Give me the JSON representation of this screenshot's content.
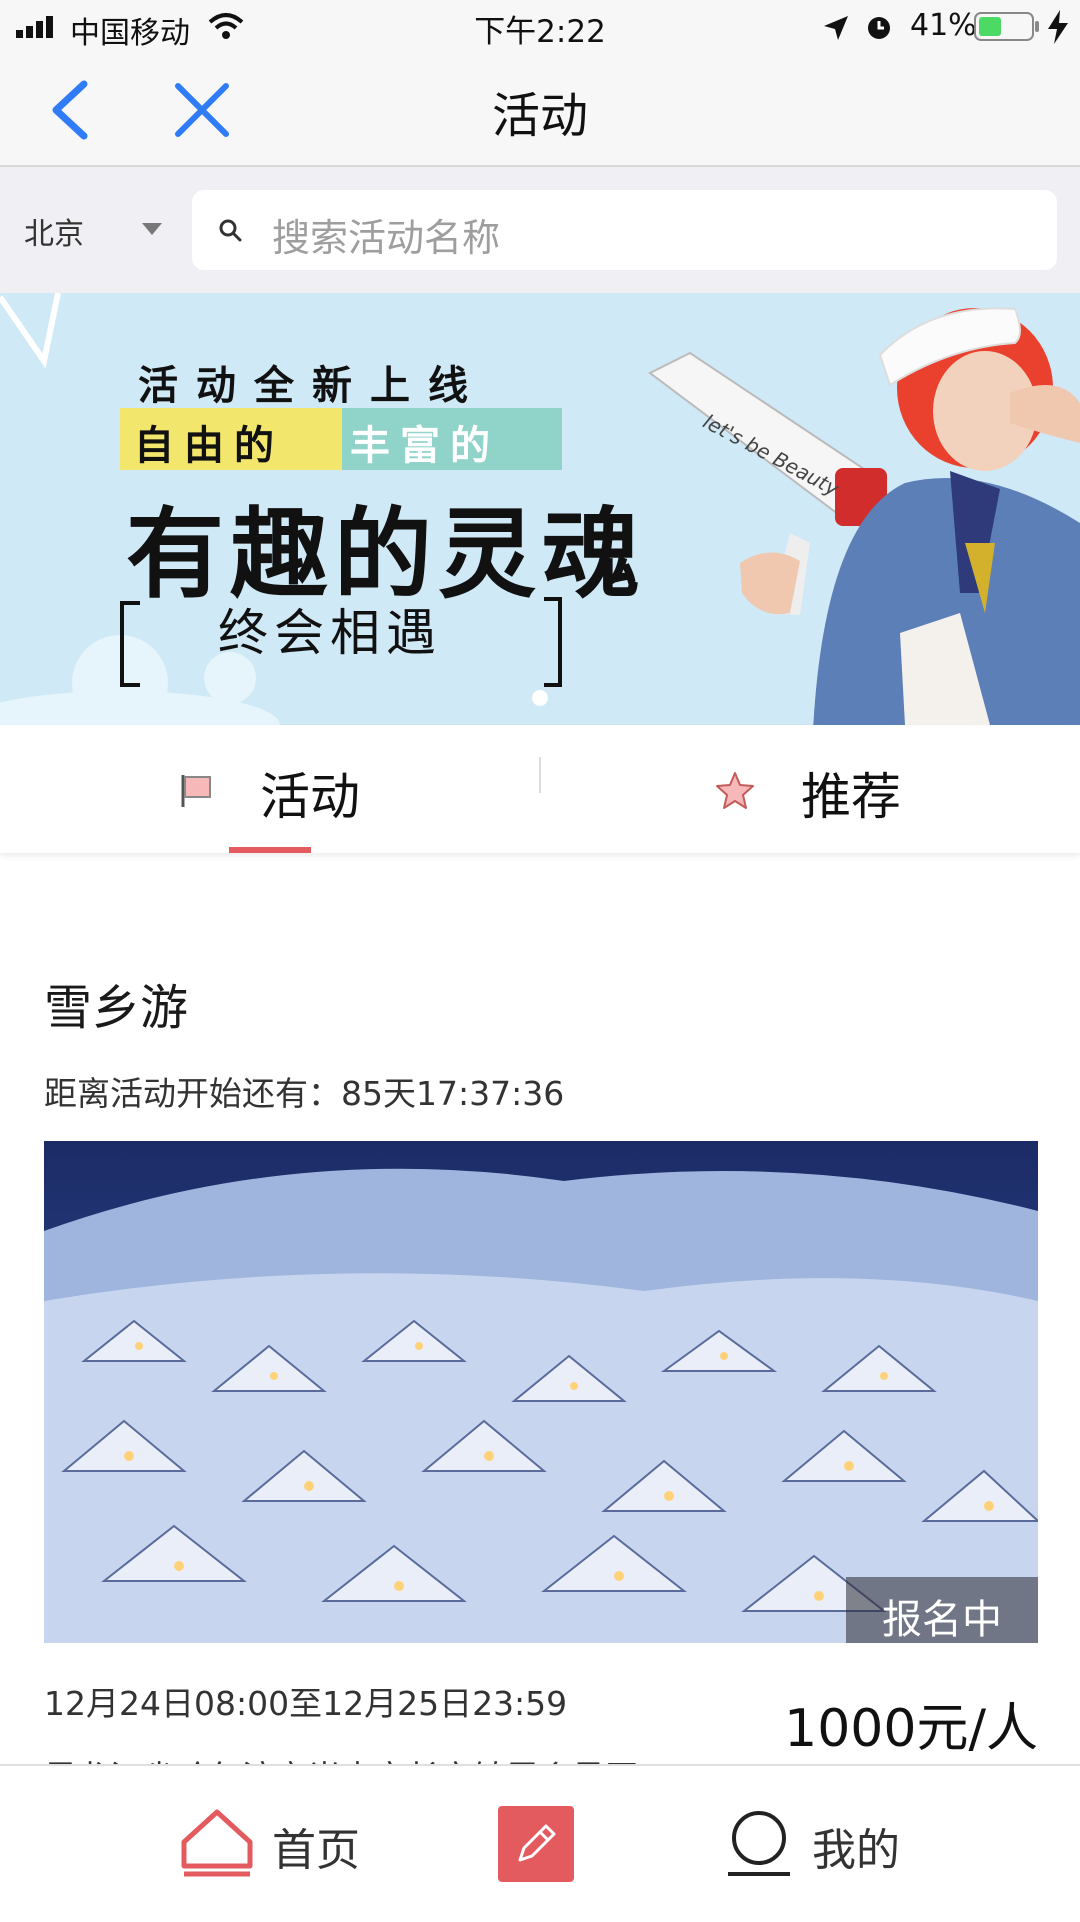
{
  "status_bar": {
    "carrier": "中国移动",
    "time": "下午2:22",
    "battery": "41%"
  },
  "nav": {
    "title": "活动",
    "back_icon": "chevron-left-icon",
    "close_icon": "close-icon"
  },
  "search": {
    "city": "北京",
    "placeholder": "搜索活动名称"
  },
  "banner": {
    "line1": "活动全新上线",
    "tag1": "自由的",
    "tag2": "丰富的",
    "headline": "有趣的灵魂",
    "subline": "终会相遇",
    "megaphone_text": "let's be Beauty",
    "active_slide": 1
  },
  "tabs": [
    {
      "label": "活动",
      "icon": "flag-icon",
      "active": true
    },
    {
      "label": "推荐",
      "icon": "star-icon",
      "active": false
    }
  ],
  "event": {
    "title": "雪乡游",
    "countdown": "距离活动开始还有：85天17:37:36",
    "status_badge": "报名中",
    "date_range": "12月24日08:00至12月25日23:59",
    "price": "1000元/人",
    "address_partial": "黑龙江省哈尔滨市尚志市长安镇雪乡景区"
  },
  "bottom_bar": {
    "home_label": "首页",
    "center_icon": "edit-pencil-icon",
    "me_label": "我的"
  },
  "colors": {
    "accent": "#e35b5e",
    "ios_blue": "#2f7cf6",
    "banner_bg": "#cfe9f6",
    "tag_yellow": "#f3e66c",
    "tag_teal": "#8fd3c9"
  }
}
